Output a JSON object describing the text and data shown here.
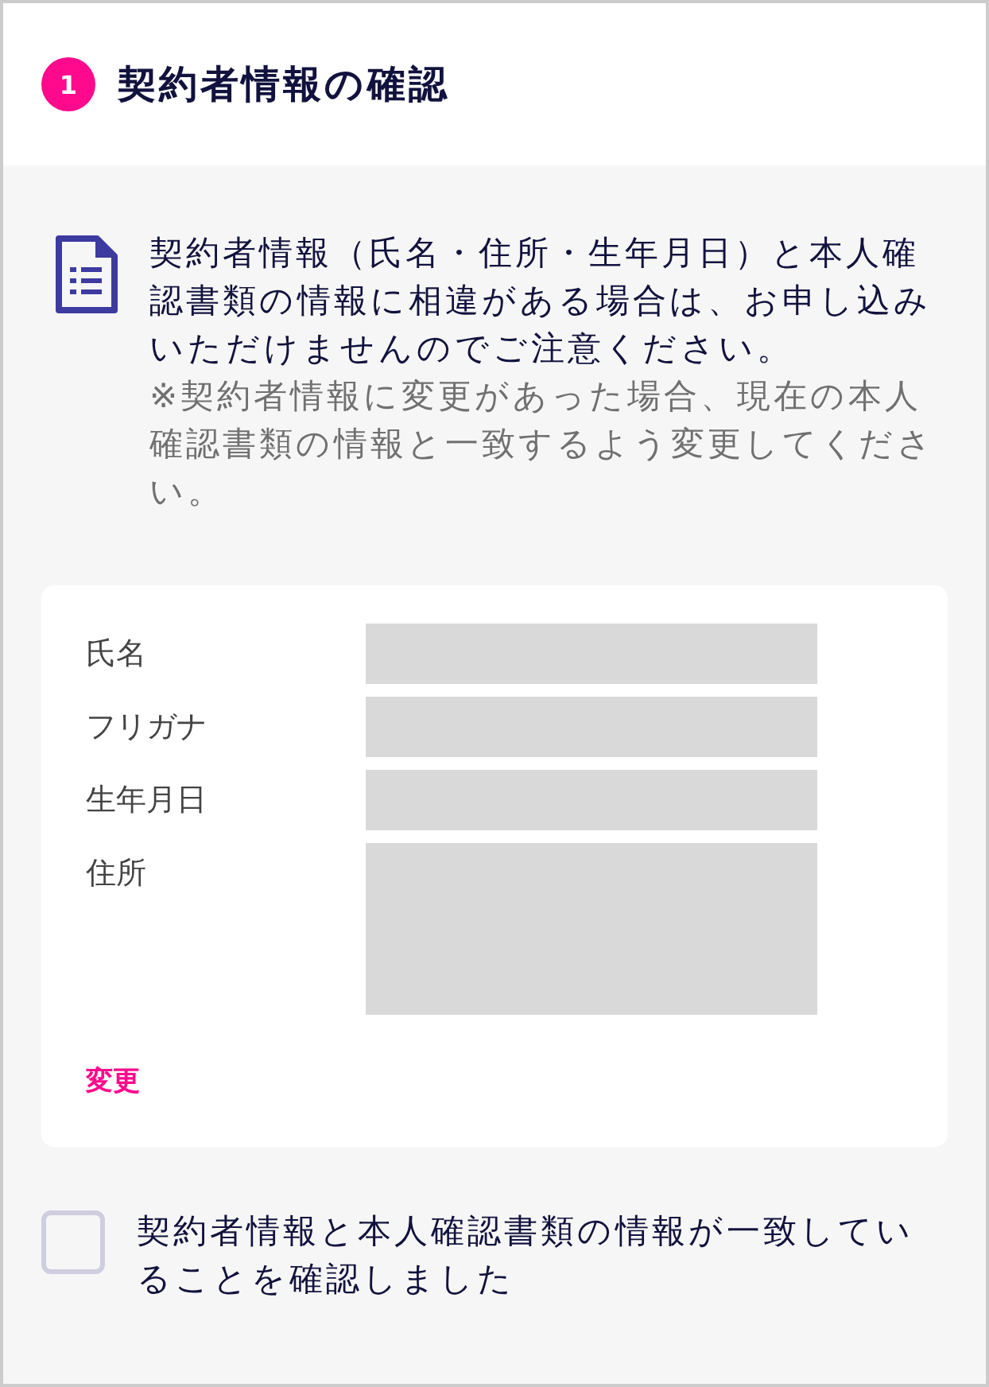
{
  "header": {
    "step": "1",
    "title": "契約者情報の確認"
  },
  "notice": {
    "message": "契約者情報（氏名・住所・生年月日）と本人確認書類の情報に相違がある場合は、お申し込みいただけませんのでご注意ください。",
    "note": "※契約者情報に変更があった場合、現在の本人確認書類の情報と一致するよう変更してください。"
  },
  "contract_info": {
    "fields": [
      {
        "label": "氏名",
        "kind": "single"
      },
      {
        "label": "フリガナ",
        "kind": "single"
      },
      {
        "label": "生年月日",
        "kind": "single"
      },
      {
        "label": "住所",
        "kind": "multi"
      }
    ],
    "change_link": "変更"
  },
  "confirmation": {
    "label": "契約者情報と本人確認書類の情報が一致していることを確認しました",
    "checked": false
  }
}
